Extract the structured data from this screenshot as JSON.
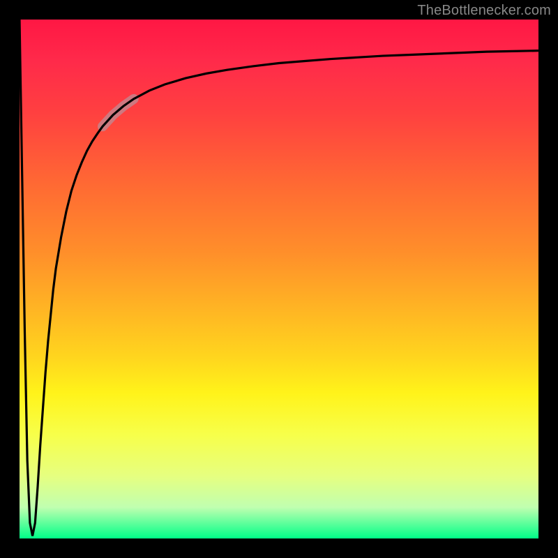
{
  "attribution": "TheBottlenecker.com",
  "chart_data": {
    "type": "line",
    "title": "",
    "xlabel": "",
    "ylabel": "",
    "xlim": [
      0,
      100
    ],
    "ylim": [
      0,
      100
    ],
    "x": [
      0,
      0.5,
      1,
      1.5,
      2,
      2.5,
      3,
      3.5,
      4,
      4.5,
      5,
      5.5,
      6,
      6.5,
      7,
      8,
      9,
      10,
      11,
      12,
      13,
      14,
      15,
      16,
      18,
      20,
      22,
      25,
      28,
      32,
      36,
      40,
      45,
      50,
      55,
      60,
      65,
      70,
      75,
      80,
      85,
      90,
      95,
      100
    ],
    "values": [
      100,
      70,
      40,
      15,
      3,
      0.5,
      3,
      10,
      18,
      25,
      32,
      38,
      43,
      48,
      52,
      58,
      63,
      67,
      70,
      72.5,
      74.7,
      76.5,
      78,
      79.4,
      81.6,
      83.3,
      84.7,
      86.3,
      87.5,
      88.7,
      89.6,
      90.3,
      91,
      91.6,
      92,
      92.4,
      92.7,
      93,
      93.2,
      93.4,
      93.6,
      93.8,
      93.9,
      94
    ],
    "highlight_range_x": [
      16,
      24
    ],
    "gradient_stops": [
      {
        "pos": 0,
        "color": "#ff1744"
      },
      {
        "pos": 18,
        "color": "#ff4040"
      },
      {
        "pos": 45,
        "color": "#ff8f2a"
      },
      {
        "pos": 72,
        "color": "#fff31a"
      },
      {
        "pos": 100,
        "color": "#00ff88"
      }
    ]
  }
}
